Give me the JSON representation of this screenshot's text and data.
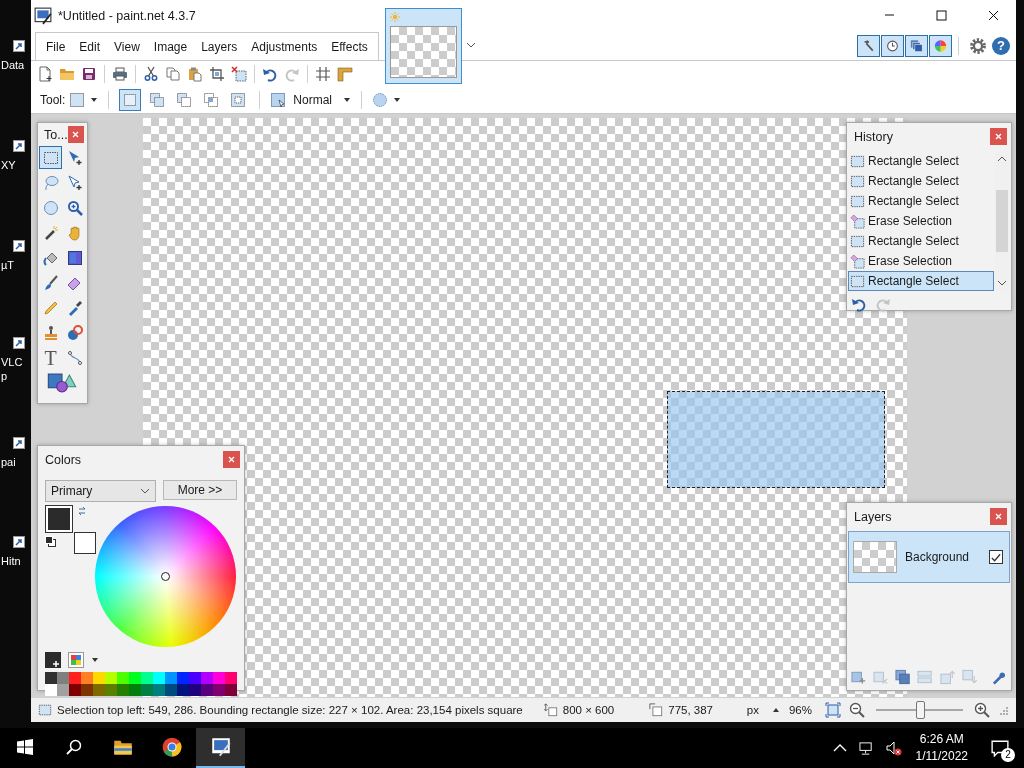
{
  "desktop_icons": [
    {
      "lines": [
        "Data"
      ]
    },
    {
      "lines": [
        "XY"
      ]
    },
    {
      "lines": [
        "µT"
      ]
    },
    {
      "lines": [
        "VLC",
        "p"
      ]
    },
    {
      "lines": [
        "pai"
      ]
    },
    {
      "lines": [
        "Hitn"
      ]
    }
  ],
  "window": {
    "title": "*Untitled - paint.net 4.3.7"
  },
  "image_tabs": [
    {
      "selected": true
    }
  ],
  "menu": [
    "File",
    "Edit",
    "View",
    "Image",
    "Layers",
    "Adjustments",
    "Effects"
  ],
  "panel_toggles": [
    {
      "kind": "tools",
      "on": true
    },
    {
      "kind": "history",
      "on": true
    },
    {
      "kind": "layers",
      "on": true
    },
    {
      "kind": "colors",
      "on": true
    }
  ],
  "help": "?",
  "toolbar": [
    {
      "kind": "new"
    },
    {
      "kind": "open"
    },
    {
      "kind": "save"
    },
    {
      "kind": "separator"
    },
    {
      "kind": "print"
    },
    {
      "kind": "separator"
    },
    {
      "kind": "cut"
    },
    {
      "kind": "copy"
    },
    {
      "kind": "paste"
    },
    {
      "kind": "crop"
    },
    {
      "kind": "deselect"
    },
    {
      "kind": "separator"
    },
    {
      "kind": "undo"
    },
    {
      "kind": "redo"
    },
    {
      "kind": "separator"
    },
    {
      "kind": "grid"
    },
    {
      "kind": "ruler"
    }
  ],
  "tool_options": {
    "label": "Tool:",
    "selection_modes": [
      {
        "kind": "replace",
        "selected": true
      },
      {
        "kind": "union",
        "selected": false
      },
      {
        "kind": "exclude",
        "selected": false
      },
      {
        "kind": "intersect",
        "selected": false
      },
      {
        "kind": "invert",
        "selected": false
      }
    ],
    "blend_mode": "Normal"
  },
  "tools_panel": {
    "title": "To...",
    "tools": [
      {
        "kind": "rect_select",
        "selected": true
      },
      {
        "kind": "move_selected",
        "selected": false
      },
      {
        "kind": "lasso",
        "selected": false
      },
      {
        "kind": "move_selection",
        "selected": false
      },
      {
        "kind": "ellipse_select",
        "selected": false
      },
      {
        "kind": "zoom",
        "selected": false
      },
      {
        "kind": "magic_wand",
        "selected": false
      },
      {
        "kind": "pan",
        "selected": false
      },
      {
        "kind": "bucket",
        "selected": false
      },
      {
        "kind": "gradient",
        "selected": false
      },
      {
        "kind": "brush",
        "selected": false
      },
      {
        "kind": "eraser",
        "selected": false
      },
      {
        "kind": "pencil",
        "selected": false
      },
      {
        "kind": "picker",
        "selected": false
      },
      {
        "kind": "clone",
        "selected": false
      },
      {
        "kind": "recolor",
        "selected": false
      },
      {
        "kind": "text",
        "glyph": "T",
        "selected": false
      },
      {
        "kind": "line",
        "selected": false
      },
      {
        "kind": "shapes",
        "selected": false
      }
    ]
  },
  "colors_panel": {
    "title": "Colors",
    "mode": "Primary",
    "more_button": "More >>",
    "primary": {
      "color": "#2b2b2b"
    },
    "secondary": {
      "color": "#ffffff"
    },
    "palette": [
      {
        "color": "#303030"
      },
      {
        "color": "#7f7f7f"
      },
      {
        "color": "#ff2020"
      },
      {
        "color": "#ff7f27"
      },
      {
        "color": "#ffd800"
      },
      {
        "color": "#b6ff00"
      },
      {
        "color": "#4cff00"
      },
      {
        "color": "#00ff21"
      },
      {
        "color": "#00ff90"
      },
      {
        "color": "#00ffff"
      },
      {
        "color": "#0094ff"
      },
      {
        "color": "#0026ff"
      },
      {
        "color": "#4800ff"
      },
      {
        "color": "#b200ff"
      },
      {
        "color": "#ff00dc"
      },
      {
        "color": "#ff006e"
      },
      {
        "color": "#ffffff"
      },
      {
        "color": "#a0a0a0"
      },
      {
        "color": "#7f0000"
      },
      {
        "color": "#7f3300"
      },
      {
        "color": "#7f6a00"
      },
      {
        "color": "#5b7f00"
      },
      {
        "color": "#267f00"
      },
      {
        "color": "#007f0e"
      },
      {
        "color": "#007f46"
      },
      {
        "color": "#007f7f"
      },
      {
        "color": "#004a7f"
      },
      {
        "color": "#00137f"
      },
      {
        "color": "#21007f"
      },
      {
        "color": "#57007f"
      },
      {
        "color": "#7f006e"
      },
      {
        "color": "#7f0037"
      }
    ]
  },
  "history_panel": {
    "title": "History",
    "items": [
      {
        "kind": "rect_select",
        "label": "Rectangle Select",
        "selected": false
      },
      {
        "kind": "rect_select",
        "label": "Rectangle Select",
        "selected": false
      },
      {
        "kind": "rect_select",
        "label": "Rectangle Select",
        "selected": false
      },
      {
        "kind": "erase",
        "label": "Erase Selection",
        "selected": false
      },
      {
        "kind": "rect_select",
        "label": "Rectangle Select",
        "selected": false
      },
      {
        "kind": "erase",
        "label": "Erase Selection",
        "selected": false
      },
      {
        "kind": "rect_select",
        "label": "Rectangle Select",
        "selected": true
      }
    ]
  },
  "layers_panel": {
    "title": "Layers",
    "layers": [
      {
        "name": "Background",
        "visible": true,
        "selected": true
      }
    ]
  },
  "status_bar": {
    "selection": "Selection top left: 549, 286. Bounding rectangle size: 227 × 102. Area: 23,154 pixels square",
    "image_size": "800 × 600",
    "cursor": "775, 387",
    "units": "px",
    "zoom": "96%",
    "zoom_slider": {
      "level": 0.5
    }
  },
  "taskbar": {
    "apps": [
      {
        "kind": "explorer",
        "active": false
      },
      {
        "kind": "browser",
        "active": false
      },
      {
        "kind": "paint",
        "active": true
      }
    ],
    "time": "6:26 AM",
    "date": "1/11/2022",
    "notifications": "2"
  }
}
